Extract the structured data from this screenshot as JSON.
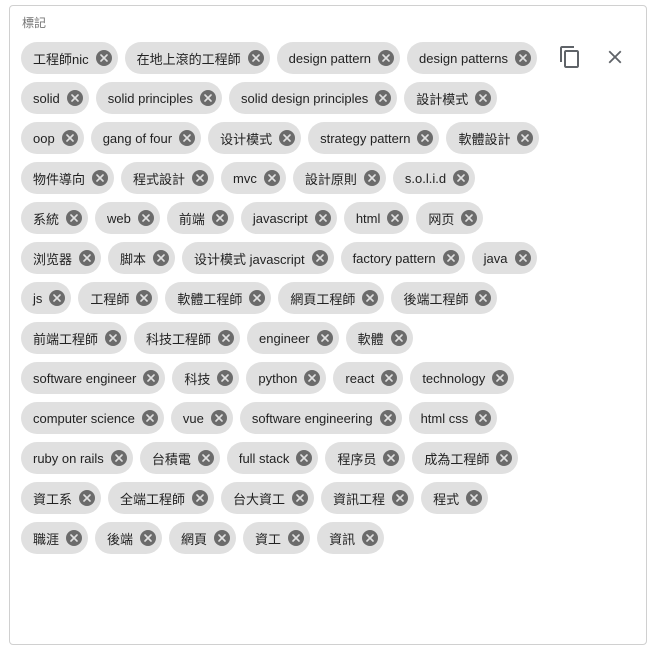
{
  "field": {
    "label": "標記",
    "copy_icon": "copy-icon",
    "clear_icon": "close-icon"
  },
  "tags": [
    "工程師nic",
    "在地上滾的工程師",
    "design pattern",
    "design patterns",
    "solid",
    "solid principles",
    "solid design principles",
    "設計模式",
    "oop",
    "gang of four",
    "设计模式",
    "strategy pattern",
    "軟體設計",
    "物件導向",
    "程式設計",
    "mvc",
    "設計原則",
    "s.o.l.i.d",
    "系統",
    "web",
    "前端",
    "javascript",
    "html",
    "网页",
    "浏览器",
    "脚本",
    "设计模式 javascript",
    "factory pattern",
    "java",
    "js",
    "工程師",
    "軟體工程師",
    "網頁工程師",
    "後端工程師",
    "前端工程師",
    "科技工程師",
    "engineer",
    "軟體",
    "software engineer",
    "科技",
    "python",
    "react",
    "technology",
    "computer science",
    "vue",
    "software engineering",
    "html css",
    "ruby on rails",
    "台積電",
    "full stack",
    "程序员",
    "成為工程師",
    "資工系",
    "全端工程師",
    "台大資工",
    "資訊工程",
    "程式",
    "職涯",
    "後端",
    "網頁",
    "資工",
    "資訊"
  ]
}
